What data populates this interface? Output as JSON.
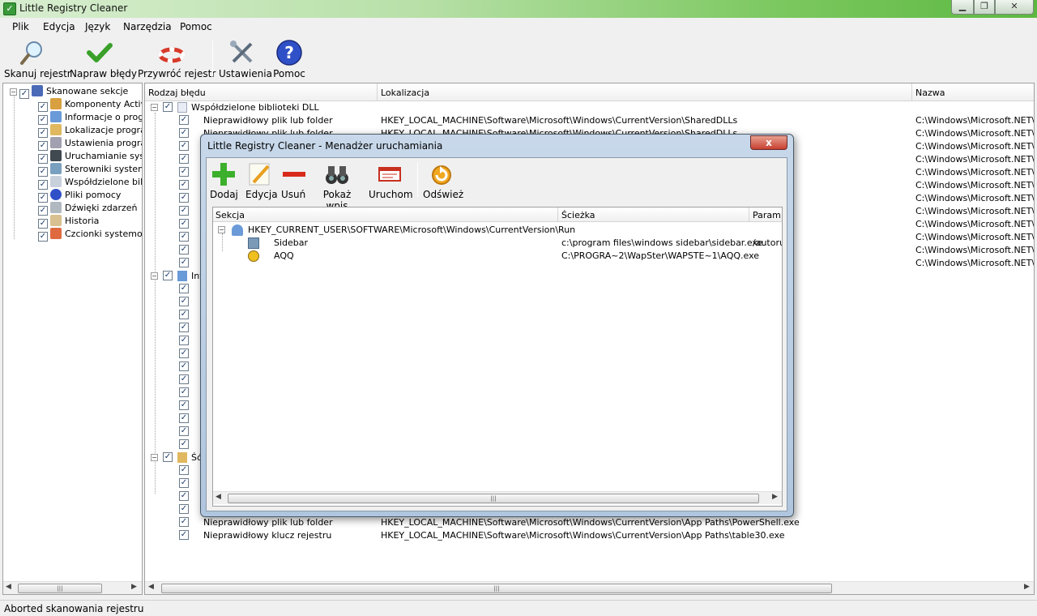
{
  "window": {
    "title": "Little Registry Cleaner"
  },
  "menu": [
    "Plik",
    "Edycja",
    "Język",
    "Narzędzia",
    "Pomoc"
  ],
  "toolbar": {
    "scan": "Skanuj rejestr",
    "fix": "Napraw błędy",
    "restore": "Przywróć rejestr",
    "settings": "Ustawienia",
    "help": "Pomoc"
  },
  "tree": {
    "root": "Skanowane sekcje",
    "items": [
      "Komponenty Active...",
      "Informacje o progran",
      "Lokalizacje program",
      "Ustawienia program",
      "Uruchamianie systei",
      "Sterowniki systemov",
      "Współdzielone bibli",
      "Pliki pomocy",
      "Dźwięki zdarzeń",
      "Historia",
      "Czcionki systemowe"
    ]
  },
  "main": {
    "columns": [
      "Rodzaj błędu",
      "Lokalizacja",
      "Nazwa"
    ],
    "group1": "Współdzielone biblioteki DLL",
    "row1_type": "Nieprawidłowy plik lub folder",
    "row1_loc": "HKEY_LOCAL_MACHINE\\Software\\Microsoft\\Windows\\CurrentVersion\\SharedDLLs",
    "row2_type": "Nieprawidłowy plik lub folder",
    "row2_loc": "HKEY_LOCAL_MACHINE\\Software\\Microsoft\\Windows\\CurrentVersion\\SharedDLLs",
    "name_value": "C:\\Windows\\Microsoft.NET\\Fra",
    "group2": "Inf",
    "group3": "Ść",
    "rowA_type": "Nieprawidłowy plik lub folder",
    "rowA_loc": "HKEY_LOCAL_MACHINE\\Software\\Microsoft\\Windows\\CurrentVersion\\App  Paths\\PowerShell.exe",
    "rowB_type": "Nieprawidłowy klucz rejestru",
    "rowB_loc": "HKEY_LOCAL_MACHINE\\Software\\Microsoft\\Windows\\CurrentVersion\\App  Paths\\table30.exe"
  },
  "status": "Aborted skanowania rejestru",
  "dialog": {
    "title": "Little Registry Cleaner - Menadżer uruchamiania",
    "close_label": "x",
    "toolbar": {
      "add": "Dodaj",
      "edit": "Edycja",
      "remove": "Usuń",
      "show": "Pokaż wpis",
      "run": "Uruchom",
      "refresh": "Odśwież"
    },
    "columns": [
      "Sekcja",
      "Ścieżka",
      "Param..."
    ],
    "key": "HKEY_CURRENT_USER\\SOFTWARE\\Microsoft\\Windows\\CurrentVersion\\Run",
    "entries": [
      {
        "name": "Sidebar",
        "path": "c:\\program files\\windows sidebar\\sidebar.exe",
        "param": "/autorur"
      },
      {
        "name": "AQQ",
        "path": "C:\\PROGRA~2\\WapSter\\WAPSTE~1\\AQQ.exe",
        "param": ""
      }
    ]
  },
  "colors": {
    "titlebar_accent": "#5cb840",
    "dialog_frame": "#b0c6de"
  }
}
